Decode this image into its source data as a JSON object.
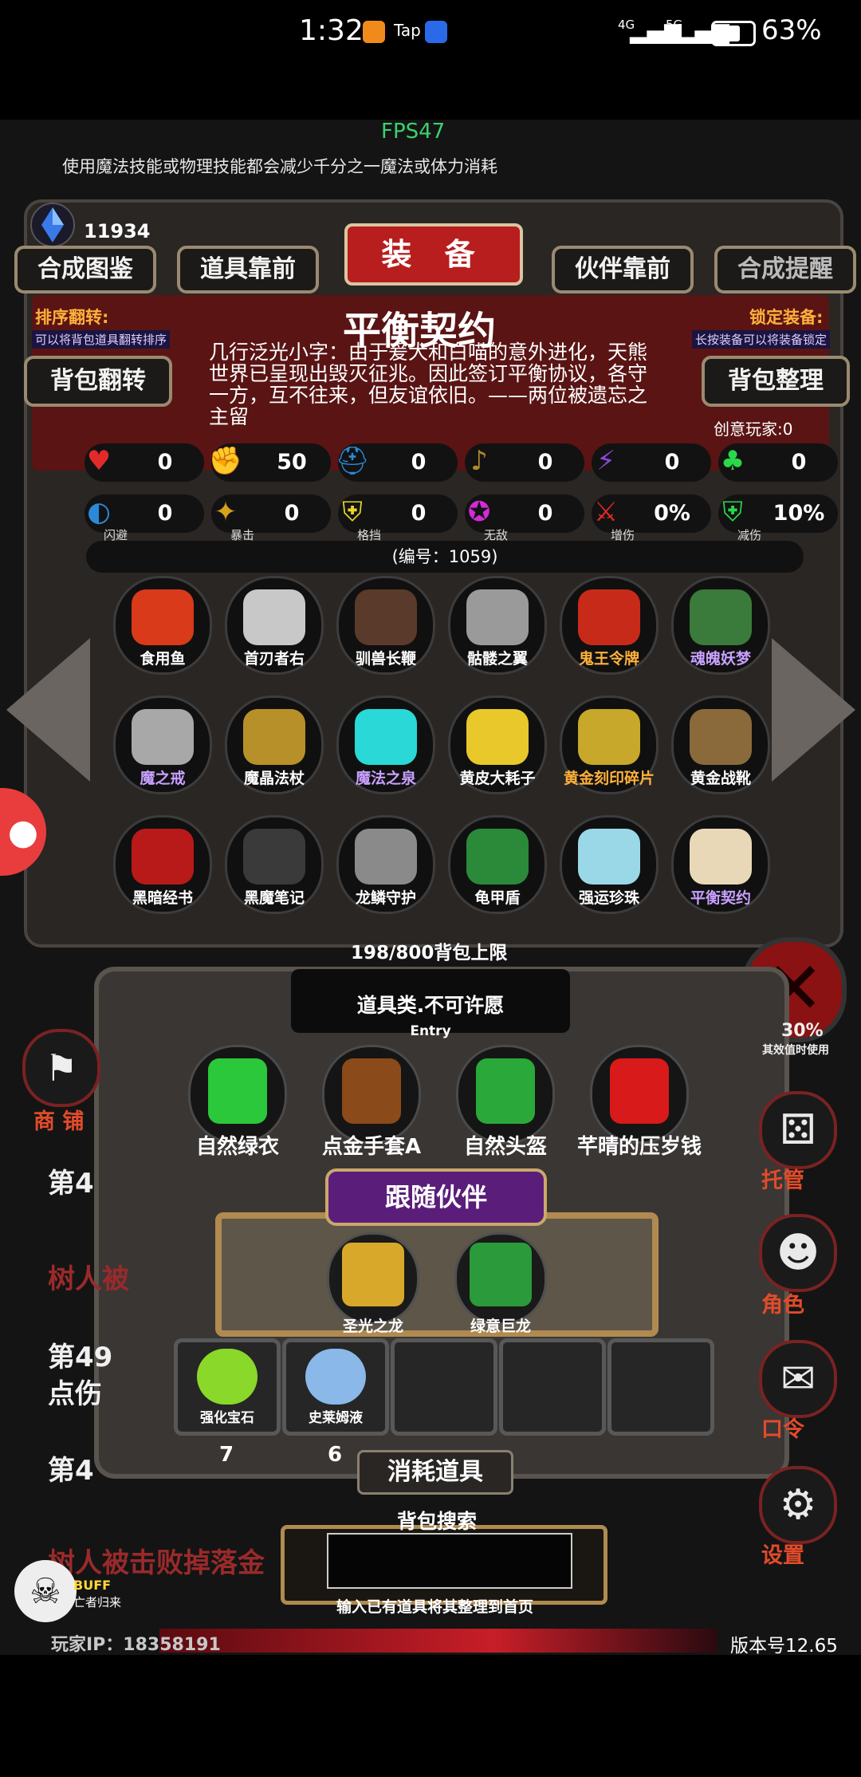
{
  "status_bar": {
    "time": "1:32",
    "app_badges": [
      "Tap"
    ],
    "network_1": "4G",
    "network_2": "5G",
    "battery": "63%"
  },
  "hud": {
    "fps": "FPS47",
    "tip": "使用魔法技能或物理技能都会减少千分之一魔法或体力消耗",
    "crystal_count": "11934"
  },
  "header": {
    "title": "装 备",
    "left_buttons": [
      "合成图鉴",
      "道具靠前"
    ],
    "right_buttons": [
      "伙伴靠前",
      "合成提醒"
    ],
    "sort_label": "排序翻转:",
    "sort_desc": "可以将背包道具翻转排序",
    "sort_button": "背包翻转",
    "lock_label": "锁定装备:",
    "lock_desc": "长按装备可以将装备锁定",
    "arrange_button": "背包整理"
  },
  "item": {
    "name": "平衡契约",
    "description": "几行泛光小字：由于爰犬和白喵的意外进化，天熊世界已呈现出毁灭征兆。因此签订平衡协议，各守一方，互不往来，但友谊依旧。——两位被遗忘之主留",
    "creative_players": "创意玩家:0",
    "serial": "(编号：1059)"
  },
  "stats_row1": [
    {
      "icon": "heart-icon",
      "value": "0",
      "color": "#e12a2a"
    },
    {
      "icon": "strength-icon",
      "value": "50",
      "color": "#d4b21c"
    },
    {
      "icon": "helmet-icon",
      "value": "0",
      "color": "#2a8ad8"
    },
    {
      "icon": "lute-icon",
      "value": "0",
      "color": "#b08a2a"
    },
    {
      "icon": "lightning-icon",
      "value": "0",
      "color": "#8a4ad8"
    },
    {
      "icon": "clover-icon",
      "value": "0",
      "color": "#2ad84a"
    }
  ],
  "stats_row2": [
    {
      "icon": "dodge-icon",
      "label": "闪避",
      "value": "0",
      "color": "#2a8ad8"
    },
    {
      "icon": "crit-icon",
      "label": "暴击",
      "value": "0",
      "color": "#d4a21c"
    },
    {
      "icon": "block-icon",
      "label": "格挡",
      "value": "0",
      "color": "#e8d42a"
    },
    {
      "icon": "invincible-icon",
      "label": "无敌",
      "value": "0",
      "color": "#d42ad8"
    },
    {
      "icon": "damage-up-icon",
      "label": "增伤",
      "value": "0%",
      "color": "#e12a2a"
    },
    {
      "icon": "damage-down-icon",
      "label": "减伤",
      "value": "10%",
      "color": "#2ad84a"
    }
  ],
  "equipment": [
    {
      "name": "食用鱼",
      "color": "#ffffff",
      "art": "#d83a1a"
    },
    {
      "name": "首刃者右",
      "color": "#ffffff",
      "art": "#c8c8c8"
    },
    {
      "name": "驯兽长鞭",
      "color": "#ffffff",
      "art": "#5a3a2a"
    },
    {
      "name": "骷髅之翼",
      "color": "#ffffff",
      "art": "#9a9a9a"
    },
    {
      "name": "鬼王令牌",
      "color": "#ffb13a",
      "art": "#c82a1a"
    },
    {
      "name": "魂魄妖梦",
      "color": "#c8a0ff",
      "art": "#3a7a3a"
    },
    {
      "name": "魔之戒",
      "color": "#c8a0ff",
      "art": "#a8a8a8"
    },
    {
      "name": "魔晶法杖",
      "color": "#ffffff",
      "art": "#b8902a"
    },
    {
      "name": "魔法之泉",
      "color": "#c8a0ff",
      "art": "#2ad8d8"
    },
    {
      "name": "黄皮大耗子",
      "color": "#ffffff",
      "art": "#e8c82a"
    },
    {
      "name": "黄金刻印碎片",
      "color": "#ffb13a",
      "art": "#c8a82a"
    },
    {
      "name": "黄金战靴",
      "color": "#ffffff",
      "art": "#8a6a3a"
    },
    {
      "name": "黑暗经书",
      "color": "#ffffff",
      "art": "#b81a1a"
    },
    {
      "name": "黑魔笔记",
      "color": "#ffffff",
      "art": "#3a3a3a"
    },
    {
      "name": "龙鳞守护",
      "color": "#ffffff",
      "art": "#8a8a8a"
    },
    {
      "name": "龟甲盾",
      "color": "#ffffff",
      "art": "#2a8a3a"
    },
    {
      "name": "强运珍珠",
      "color": "#ffffff",
      "art": "#9ad8e8"
    },
    {
      "name": "平衡契约",
      "color": "#c8a0ff",
      "art": "#e8d8b8"
    }
  ],
  "bag": {
    "limit": "198/800背包上限",
    "entry_title": "道具类.不可许愿",
    "entry_sub": "Entry",
    "gifts": [
      {
        "name": "自然绿衣",
        "art": "#2ac83a"
      },
      {
        "name": "点金手套A",
        "art": "#8a4a1a"
      },
      {
        "name": "自然头盔",
        "art": "#2aa83a"
      },
      {
        "name": "芊晴的压岁钱",
        "art": "#d81a1a"
      }
    ],
    "partner_banner": "跟随伙伴",
    "partners": [
      {
        "name": "圣光之龙",
        "art": "#d8a82a"
      },
      {
        "name": "绿意巨龙",
        "art": "#2a9a3a"
      }
    ],
    "consumables": [
      {
        "name": "强化宝石",
        "count": "7",
        "art": "#8ad82a"
      },
      {
        "name": "史莱姆液",
        "count": "6",
        "art": "#8ab8e8"
      },
      {
        "name": "",
        "count": "",
        "art": ""
      },
      {
        "name": "",
        "count": "",
        "art": ""
      },
      {
        "name": "",
        "count": "",
        "art": ""
      }
    ],
    "consume_label": "消耗道具",
    "search_label": "背包搜索",
    "search_hint": "输入已有道具将其整理到首页"
  },
  "side": {
    "shop": "商 铺",
    "timer_value": "30%",
    "timer_note": "其效值时使用",
    "right": [
      {
        "label": "托管",
        "icon": "dice-icon"
      },
      {
        "label": "角色",
        "icon": "hood-icon"
      },
      {
        "label": "口令",
        "icon": "book-icon"
      },
      {
        "label": "设置",
        "icon": "gear-icon"
      }
    ]
  },
  "log": {
    "lines": [
      "第4",
      "树人被",
      "第49",
      "点伤",
      "第4",
      "树人被击败掉落金"
    ]
  },
  "footer": {
    "buff_title": "BUFF",
    "buff_sub": "亡者归来",
    "ip": "玩家IP：18358191",
    "version": "版本号12.65"
  }
}
